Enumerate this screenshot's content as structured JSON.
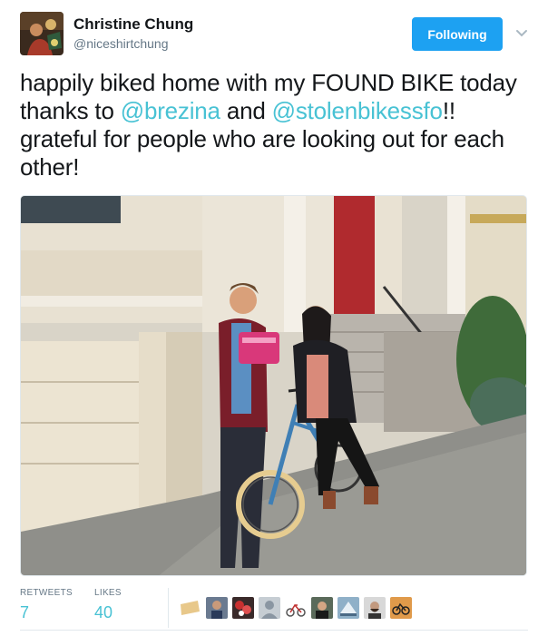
{
  "user": {
    "name": "Christine Chung",
    "handle": "@niceshirtchung",
    "follow_label": "Following"
  },
  "tweet": {
    "text_1": "happily biked home with my FOUND BIKE today thanks to ",
    "mention_1": "@brezina",
    "text_2": " and ",
    "mention_2": "@stolenbikessfo",
    "text_3": "!! grateful for people who are looking out for each other!"
  },
  "stats": {
    "retweets_label": "RETWEETS",
    "retweets_value": "7",
    "likes_label": "LIKES",
    "likes_value": "40"
  },
  "icons": {
    "chevron": "chevron-down-icon"
  },
  "colors": {
    "accent": "#1da1f2",
    "mention": "#48c2d4",
    "muted": "#657786"
  }
}
